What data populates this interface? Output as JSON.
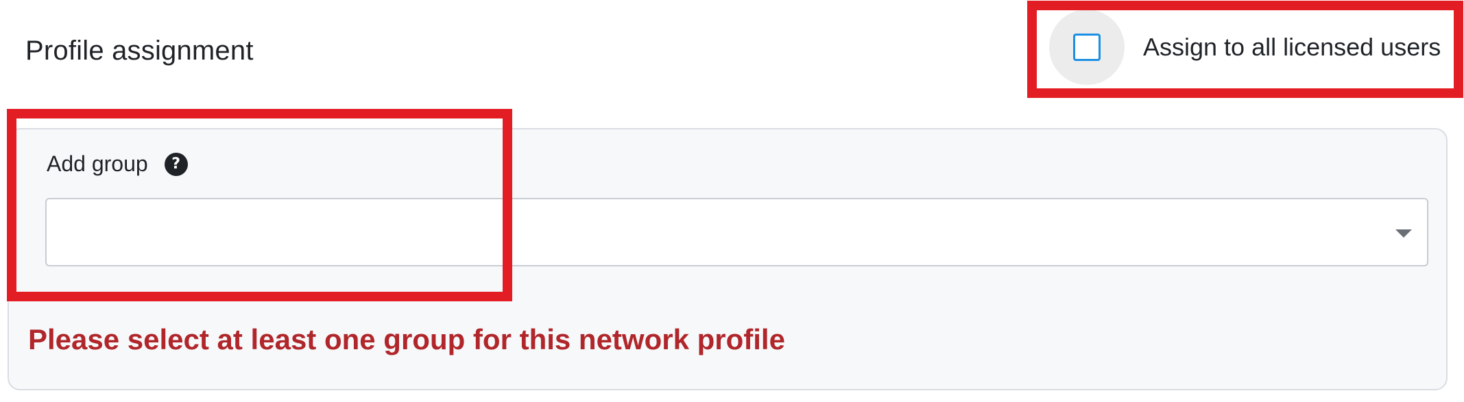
{
  "section": {
    "title": "Profile assignment"
  },
  "assign_all": {
    "label": "Assign to all licensed users",
    "checked": false
  },
  "group_field": {
    "label": "Add group",
    "help_icon": "question-circle-icon",
    "value": "",
    "error": "Please select at least one group for this network profile"
  },
  "colors": {
    "checkbox_border": "#1a8fe3",
    "error_text": "#b0262a",
    "highlight": "#e21d23"
  }
}
